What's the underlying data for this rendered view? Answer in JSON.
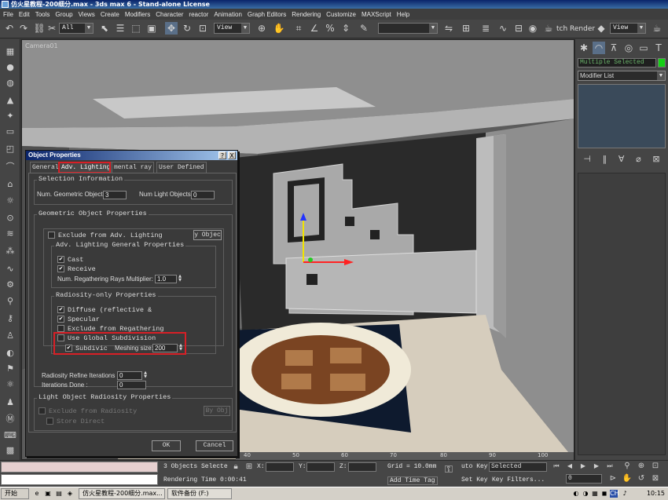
{
  "window": {
    "title": "仿火星教程-200细分.max - 3ds max 6 - Stand-alone License"
  },
  "menubar": [
    "File",
    "Edit",
    "Tools",
    "Group",
    "Views",
    "Create",
    "Modifiers",
    "Character",
    "reactor",
    "Animation",
    "Graph Editors",
    "Rendering",
    "Customize",
    "MAXScript",
    "Help"
  ],
  "toolbar": {
    "selection_filter": "All",
    "ref_coord": "View",
    "render_label": "tch Render",
    "render_view": "View"
  },
  "viewport": {
    "label": "Camera01"
  },
  "command_panel": {
    "selection_name": "Multiple Selected",
    "modifier_list": "Modifier List",
    "selection_color": "#16d016"
  },
  "dialog": {
    "title": "Object Properties",
    "help_btn": "?",
    "close_btn": "X",
    "tabs": [
      "General",
      "Adv. Lighting",
      "mental ray",
      "User Defined"
    ],
    "active_tab": "Adv. Lighting",
    "selection_info": {
      "title": "Selection Information",
      "num_geo_label": "Num. Geometric Objects:",
      "num_geo_value": "3",
      "num_light_label": "Num Light Objects:",
      "num_light_value": "0"
    },
    "geometric": {
      "title": "Geometric Object Properties",
      "exclude_label": "Exclude from Adv. Lighting",
      "exclude_checked": false,
      "by_object_btn": "y Objec",
      "general_title": "Adv. Lighting General Properties",
      "cast_label": "Cast",
      "cast_checked": true,
      "receive_label": "Receive",
      "receive_checked": true,
      "regather_label": "Num. Regathering Rays Multiplier:",
      "regather_value": "1.0",
      "radiosity_title": "Radiosity-only Properties",
      "diffuse_label": "Diffuse (reflective &",
      "diffuse_checked": true,
      "specular_label": "Specular",
      "specular_checked": true,
      "exclude_regather_label": "Exclude from Regathering",
      "exclude_regather_checked": false,
      "global_subdiv_label": "Use Global Subdivision",
      "global_subdiv_checked": false,
      "subdivide_label": "Subdivic",
      "subdivide_checked": true,
      "meshing_label": "Meshing size:",
      "meshing_value": "200"
    },
    "refine": {
      "refine_label": "Radiosity Refine Iterations :",
      "refine_value": "0",
      "done_label": "Iterations Done :",
      "done_value": "0"
    },
    "light": {
      "title": "Light Object Radiosity Properties",
      "exclude_label": "Exclude from Radiosity",
      "store_label": "Store Direct",
      "by_object_btn": "By Obj"
    },
    "ok": "OK",
    "cancel": "Cancel"
  },
  "timeline": {
    "ticks": [
      "40",
      "50",
      "60",
      "70",
      "80",
      "90",
      "100"
    ]
  },
  "status": {
    "selected": "3 Objects Selecte",
    "x_label": "X:",
    "y_label": "Y:",
    "z_label": "Z:",
    "grid": "Grid = 10.0mm",
    "auto_key": "uto Key",
    "key_mode": "Selected",
    "rendering_time": "Rendering Time  0:00:41",
    "add_time_tag": "Add Time Tag",
    "set_key": "Set Key",
    "key_filters": "Key Filters...",
    "frame": "0"
  },
  "taskbar": {
    "start": "开始",
    "task1": "仿火星教程-200细分.max...",
    "task2": "软件备份 (F:)",
    "clock": "10:15",
    "ime": "CH"
  }
}
